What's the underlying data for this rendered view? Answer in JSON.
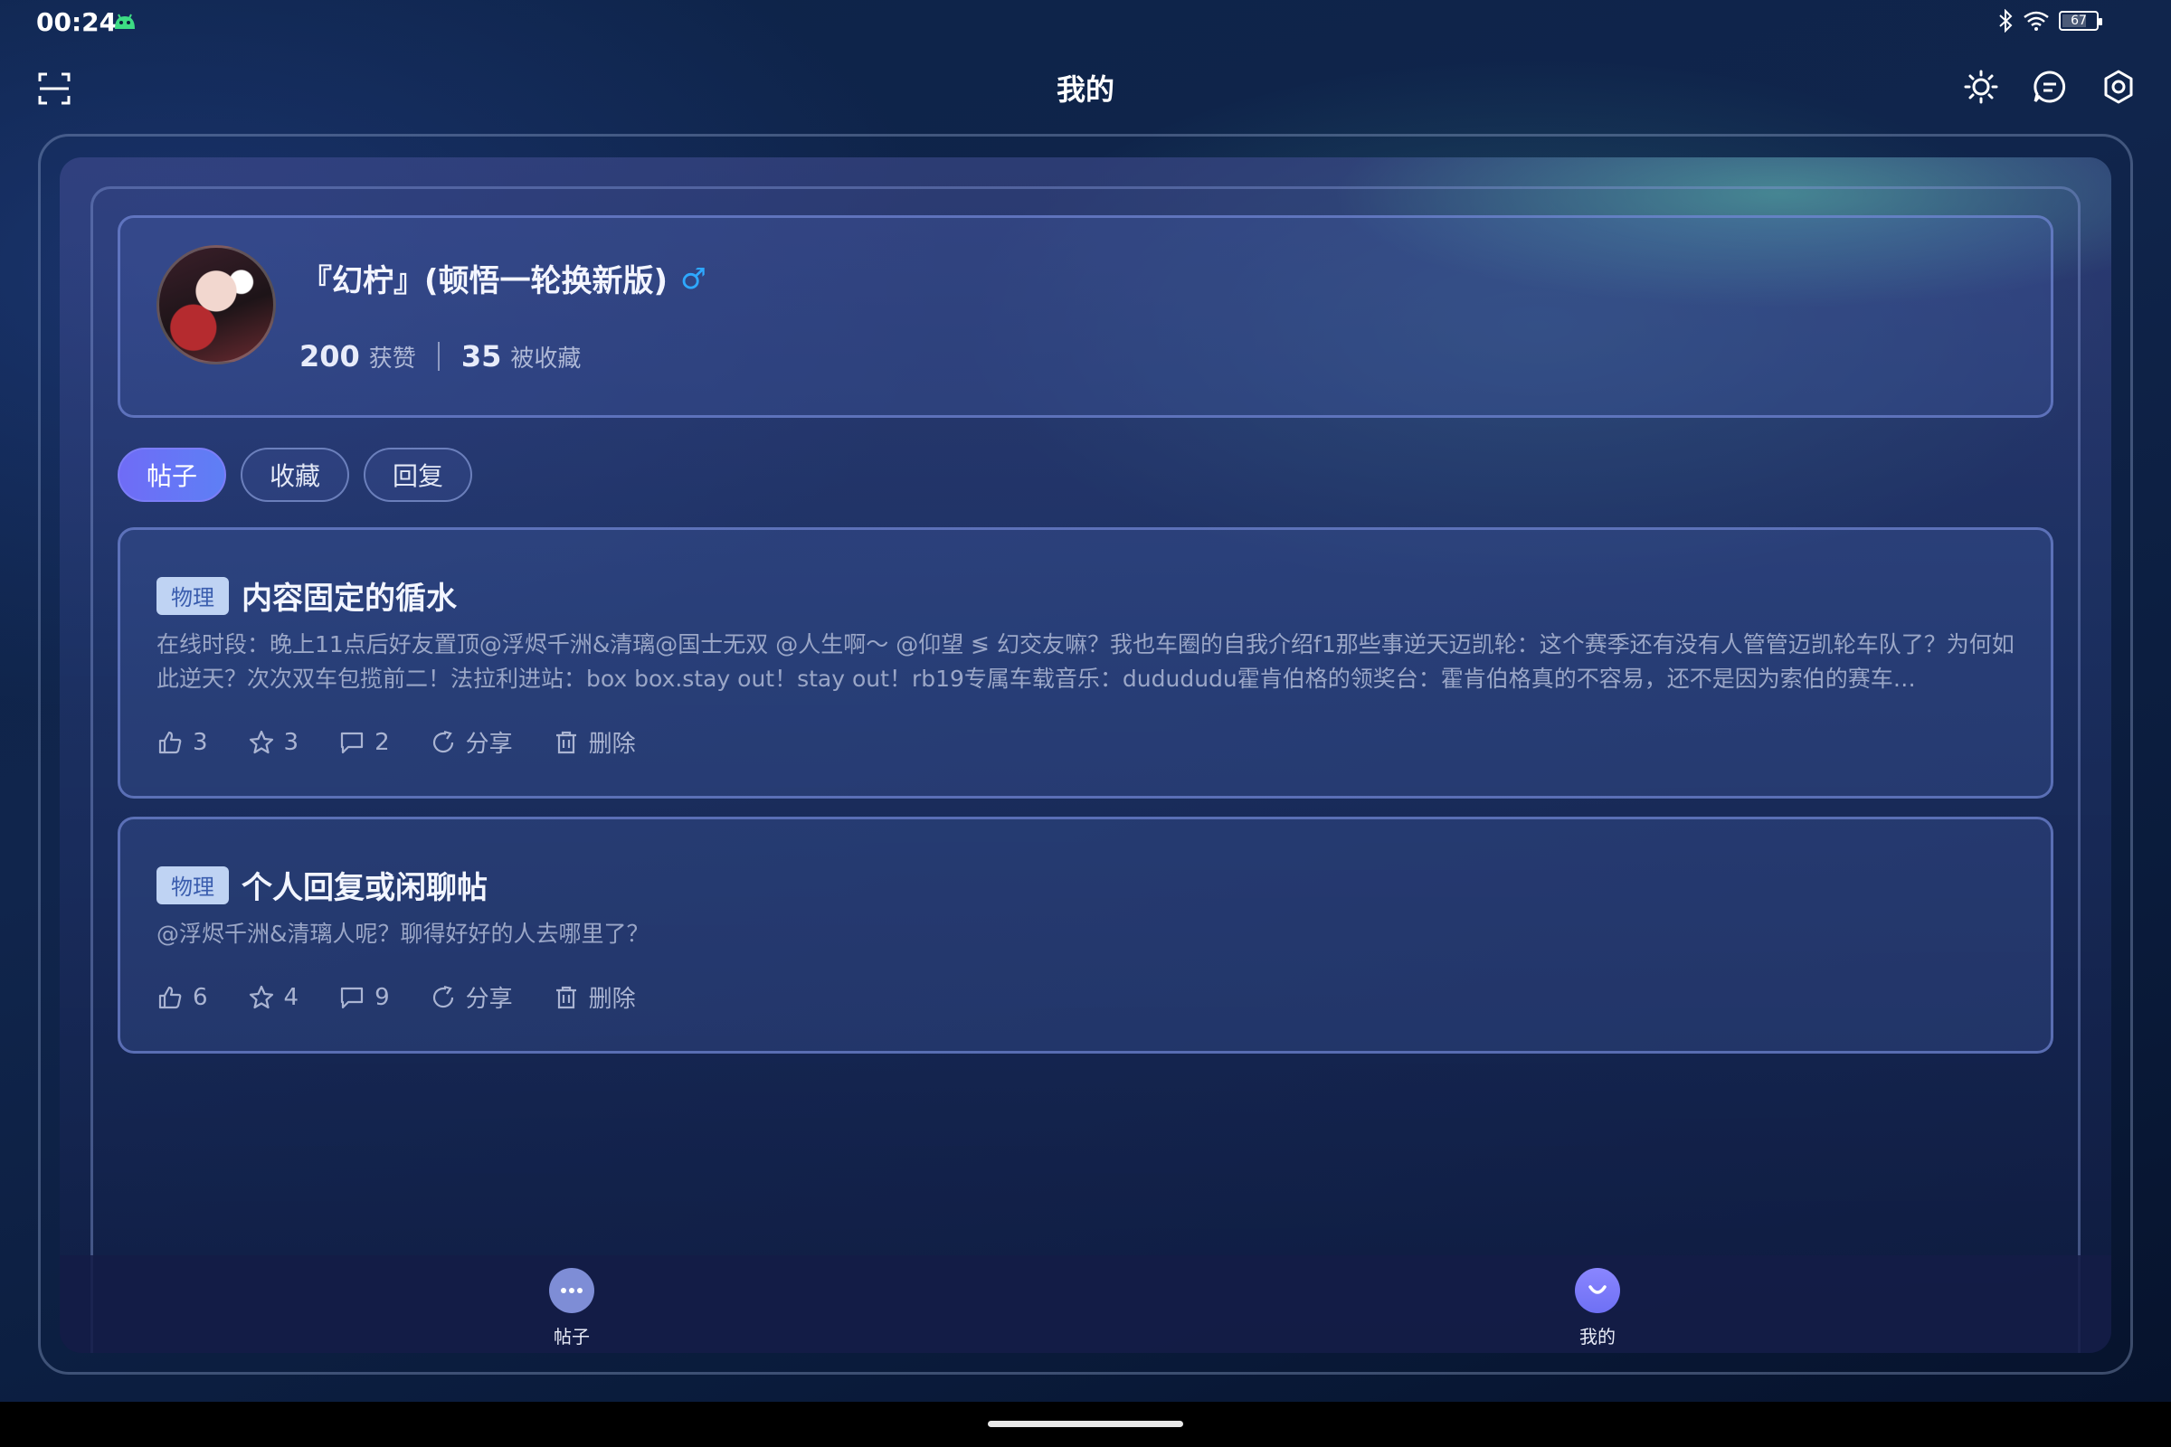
{
  "status_bar": {
    "time": "00:24",
    "battery": "67",
    "battery_level": 0.67
  },
  "header": {
    "title": "我的"
  },
  "profile": {
    "username": "『幻柠』(顿悟一轮换新版)",
    "gender_symbol": "♂",
    "likes_count": "200",
    "likes_label": "获赞",
    "favorited_count": "35",
    "favorited_label": "被收藏"
  },
  "tabs": [
    {
      "label": "帖子",
      "active": true
    },
    {
      "label": "收藏",
      "active": false
    },
    {
      "label": "回复",
      "active": false
    }
  ],
  "posts": [
    {
      "tag": "物理",
      "title": "内容固定的循水",
      "body": "在线时段：晚上11点后好友置顶@浮烬千洲&清璃@国士无双 @人生啊～ @仰望 ≶ 幻交友嘛？我也车圈的自我介绍f1那些事逆天迈凯轮：这个赛季还有没有人管管迈凯轮车队了？为何如此逆天？次次双车包揽前二！法拉利进站：box box.stay out！stay out！rb19专属车载音乐：dudududu霍肯伯格的领奖台：霍肯伯格真的不容易，还不是因为索伯的赛车…",
      "likes": "3",
      "stars": "3",
      "comments": "2",
      "share_label": "分享",
      "delete_label": "删除"
    },
    {
      "tag": "物理",
      "title": "个人回复或闲聊帖",
      "body": "@浮烬千洲&清璃人呢？聊得好好的人去哪里了？",
      "likes": "6",
      "stars": "4",
      "comments": "9",
      "share_label": "分享",
      "delete_label": "删除"
    }
  ],
  "bottom_nav": [
    {
      "label": "帖子",
      "icon": "chat-bubble-icon"
    },
    {
      "label": "我的",
      "icon": "smile-avatar-icon"
    }
  ],
  "colors": {
    "accent": "#6f6cf6",
    "tag_bg": "#bfd3f3",
    "gender": "#2ea8ff"
  }
}
